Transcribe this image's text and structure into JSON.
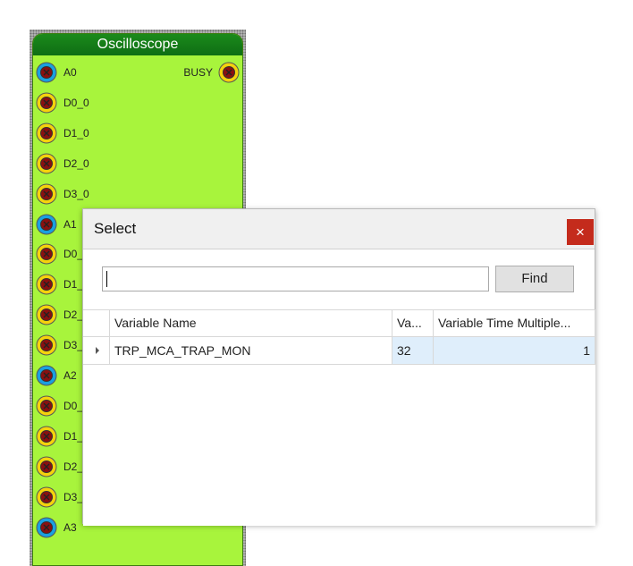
{
  "block": {
    "title": "Oscilloscope",
    "busy_label": "BUSY",
    "pins": [
      {
        "label": "A0",
        "type": "analog"
      },
      {
        "label": "D0_0",
        "type": "digital"
      },
      {
        "label": "D1_0",
        "type": "digital"
      },
      {
        "label": "D2_0",
        "type": "digital"
      },
      {
        "label": "D3_0",
        "type": "digital"
      },
      {
        "label": "A1",
        "type": "analog"
      },
      {
        "label": "D0_",
        "type": "digital"
      },
      {
        "label": "D1_",
        "type": "digital"
      },
      {
        "label": "D2_",
        "type": "digital"
      },
      {
        "label": "D3_",
        "type": "digital"
      },
      {
        "label": "A2",
        "type": "analog"
      },
      {
        "label": "D0_",
        "type": "digital"
      },
      {
        "label": "D1_",
        "type": "digital"
      },
      {
        "label": "D2_",
        "type": "digital"
      },
      {
        "label": "D3_",
        "type": "digital"
      },
      {
        "label": "A3",
        "type": "analog"
      }
    ],
    "colors": {
      "body": "#a8f43c",
      "header": "#0f6e14",
      "analog": "#1aa0e0",
      "digital": "#f5d20c",
      "pin_center": "#8a1010"
    }
  },
  "dialog": {
    "title": "Select",
    "close_label": "×",
    "search": {
      "value": "",
      "placeholder": ""
    },
    "find_label": "Find",
    "columns": [
      "Variable Name",
      "Va...",
      "Variable Time Multiple..."
    ],
    "rows": [
      {
        "name": "TRP_MCA_TRAP_MON",
        "value": "32",
        "time_multiple": "1"
      }
    ],
    "close_color": "#c42b1c"
  }
}
